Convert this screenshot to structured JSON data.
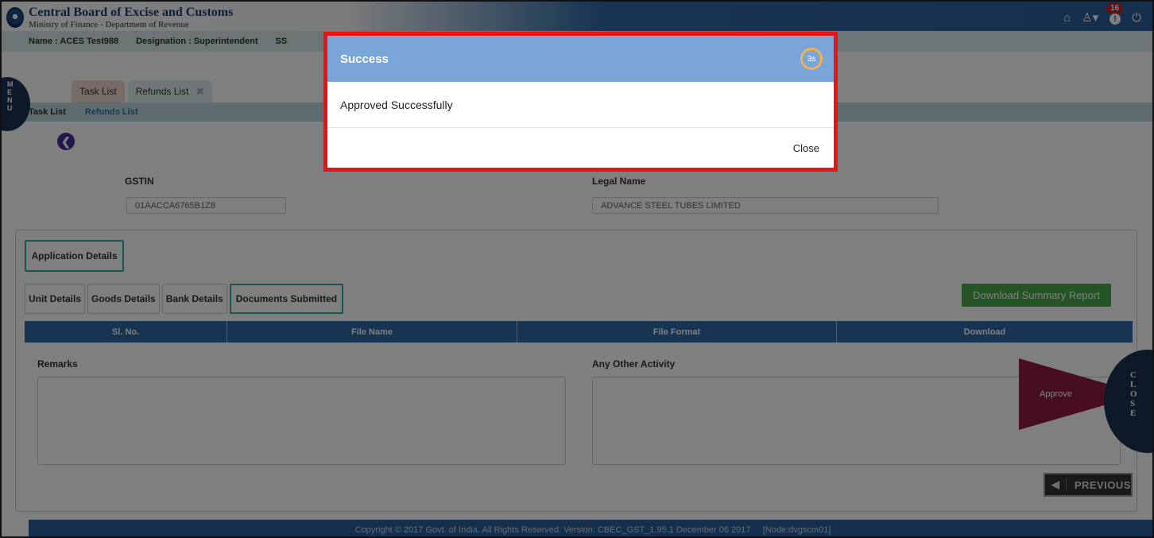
{
  "header": {
    "title": "Central Board of Excise and Customs",
    "subtitle": "Ministry of Finance - Department of Revenue",
    "notification_count": "16"
  },
  "userbar": {
    "name": "Name : ACES Test988",
    "designation": "Designation : Superintendent",
    "ssi": "SS"
  },
  "menu_label": "M\nE\nN\nU",
  "tabs": [
    {
      "label": "Task List"
    },
    {
      "label": "Refunds List"
    }
  ],
  "breadcrumb": [
    "Task List",
    "Refunds List"
  ],
  "form": {
    "gstin_label": "GSTIN",
    "gstin_value": "01AACCA6765B1Z8",
    "legal_name_label": "Legal Name",
    "legal_name_value": "ADVANCE STEEL TUBES LIMITED",
    "application_details": "Application Details",
    "subtabs": [
      "Unit Details",
      "Goods Details",
      "Bank Details",
      "Documents Submitted"
    ],
    "download_button": "Download Summary Report",
    "table_headers": [
      "Sl. No.",
      "File Name",
      "File Format",
      "Download"
    ],
    "remarks_label": "Remarks",
    "other_activity_label": "Any Other Activity",
    "approve_label": "Approve",
    "close_label": "C\nL\nO\nS\nE",
    "previous_label": "PREVIOUS"
  },
  "footer": "Copyright © 2017 Govt. of India. All Rights Reserved. Version: CBEC_GST_1.95.1 December 06 2017     [Node:dvgscm01]",
  "modal": {
    "title": "Success",
    "timer": "3s",
    "message": "Approved Successfully",
    "close_label": "Close"
  },
  "colors": {
    "header_blue": "#2a5f98",
    "success_header": "#7aa5d8",
    "modal_border": "#e81313",
    "approve": "#8c1d41",
    "download_green": "#4ca650"
  }
}
